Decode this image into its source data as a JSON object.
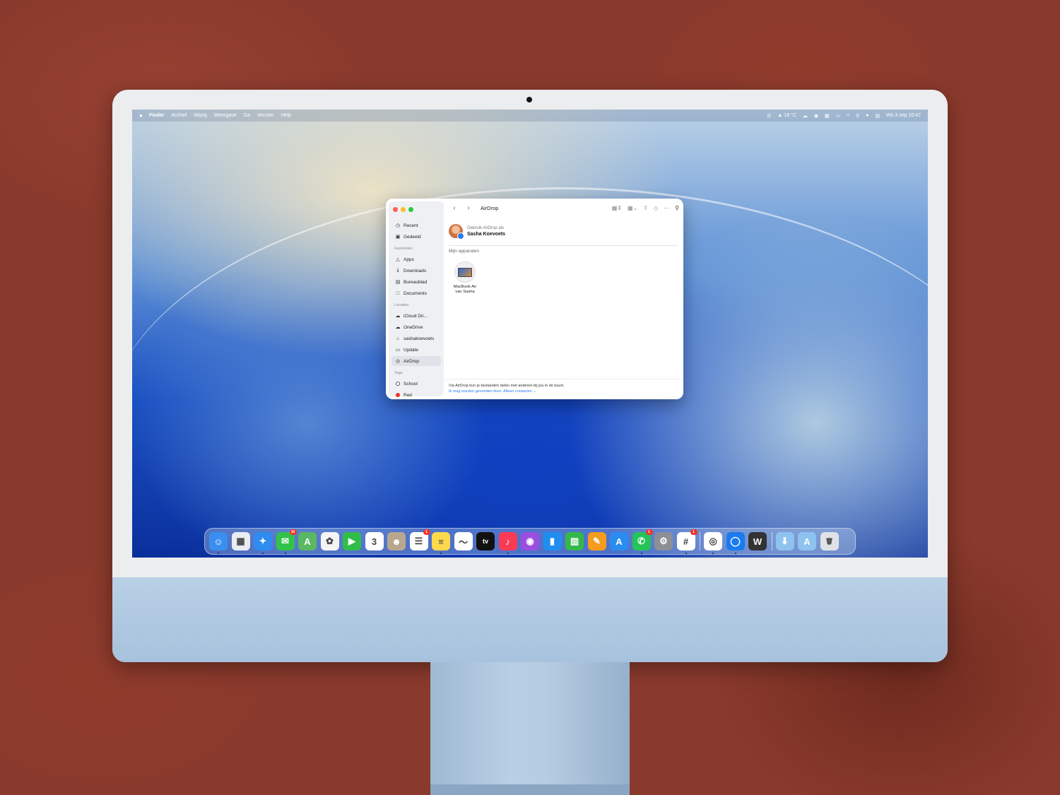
{
  "menubar": {
    "app": "Finder",
    "menus": [
      "Archief",
      "Wijzig",
      "Weergave",
      "Ga",
      "Venster",
      "Help"
    ],
    "weather": "19 °C",
    "clock": "Wo 3 sep  10:47"
  },
  "window": {
    "title": "AirDrop",
    "sidebar": {
      "items_top": [
        {
          "label": "Recent",
          "icon": "clock-icon"
        },
        {
          "label": "Gedeeld",
          "icon": "shared-folder-icon"
        }
      ],
      "favorites_header": "Favorieten",
      "favorites": [
        {
          "label": "Apps",
          "icon": "apps-icon"
        },
        {
          "label": "Downloads",
          "icon": "download-icon"
        },
        {
          "label": "Bureaublad",
          "icon": "desktop-icon"
        },
        {
          "label": "Documents",
          "icon": "document-icon"
        }
      ],
      "locations_header": "Locaties",
      "locations": [
        {
          "label": "iCloud Dri...",
          "icon": "cloud-icon"
        },
        {
          "label": "OneDrive",
          "icon": "cloud-icon"
        },
        {
          "label": "sashakoevoets",
          "icon": "home-icon"
        },
        {
          "label": "Update",
          "icon": "drive-icon"
        },
        {
          "label": "AirDrop",
          "icon": "airdrop-icon"
        }
      ],
      "tags_header": "Tags",
      "tags": [
        {
          "label": "School",
          "color": "#ffffff"
        },
        {
          "label": "Red",
          "color": "#e8352b"
        }
      ]
    },
    "me": {
      "label": "Gebruik AirDrop als",
      "name": "Sasha Koevoets"
    },
    "section": "Mijn apparaten",
    "device": {
      "line1": "MacBook Air",
      "line2": "van Sasha"
    },
    "footer": {
      "info": "Via AirDrop kun je bestanden delen met anderen bij jou in de buurt.",
      "discoverable": "Ik mag worden gevonden door: Alleen contacten"
    }
  },
  "dock": [
    {
      "name": "Finder",
      "icon": "finder-icon",
      "color": "#3a8ef0",
      "glyph": "☺",
      "running": true
    },
    {
      "name": "Launchpad",
      "icon": "launchpad-icon",
      "color": "#e9ecf2",
      "glyph": "▦"
    },
    {
      "name": "Safari",
      "icon": "safari-icon",
      "color": "#2f8cf0",
      "glyph": "✦",
      "running": true
    },
    {
      "name": "Berichten",
      "icon": "messages-icon",
      "color": "#31c24a",
      "glyph": "✉",
      "badge": "10",
      "running": true
    },
    {
      "name": "Kaarten",
      "icon": "maps-icon",
      "color": "#59b861",
      "glyph": "A"
    },
    {
      "name": "Foto's",
      "icon": "photos-icon",
      "color": "#f4f4f4",
      "glyph": "✿"
    },
    {
      "name": "FaceTime",
      "icon": "facetime-icon",
      "color": "#2fbe4a",
      "glyph": "▶"
    },
    {
      "name": "Agenda",
      "icon": "calendar-icon",
      "color": "#ffffff",
      "glyph": "3"
    },
    {
      "name": "Contacten",
      "icon": "contacts-icon",
      "color": "#b7a88d",
      "glyph": "☻"
    },
    {
      "name": "Herinneringen",
      "icon": "reminders-icon",
      "color": "#ffffff",
      "glyph": "☰",
      "badge": "1"
    },
    {
      "name": "Notities",
      "icon": "notes-icon",
      "color": "#fcd84b",
      "glyph": "≡",
      "running": true
    },
    {
      "name": "Freeform",
      "icon": "freeform-icon",
      "color": "#ffffff",
      "glyph": "〜"
    },
    {
      "name": "Apple TV",
      "icon": "tv-icon",
      "color": "#111111",
      "glyph": "tv"
    },
    {
      "name": "Muziek",
      "icon": "music-icon",
      "color": "#fa3a55",
      "glyph": "♪",
      "running": true
    },
    {
      "name": "Podcasts",
      "icon": "podcasts-icon",
      "color": "#9a4fe0",
      "glyph": "◉"
    },
    {
      "name": "Keynote",
      "icon": "keynote-icon",
      "color": "#1f8ef1",
      "glyph": "▮"
    },
    {
      "name": "Numbers",
      "icon": "numbers-icon",
      "color": "#33b84a",
      "glyph": "▥"
    },
    {
      "name": "Pages",
      "icon": "pages-icon",
      "color": "#f59b1d",
      "glyph": "✎"
    },
    {
      "name": "App Store",
      "icon": "appstore-icon",
      "color": "#2b8cf0",
      "glyph": "A"
    },
    {
      "name": "WhatsApp",
      "icon": "whatsapp-icon",
      "color": "#25c35a",
      "glyph": "✆",
      "badge": "1",
      "running": true
    },
    {
      "name": "Systeeminstellingen",
      "icon": "settings-icon",
      "color": "#8c8f95",
      "glyph": "⚙"
    },
    {
      "name": "Slack",
      "icon": "slack-icon",
      "color": "#ffffff",
      "glyph": "#",
      "badge": "1",
      "running": true
    }
  ],
  "dock_apps2": [
    {
      "name": "Chrome",
      "icon": "chrome-icon",
      "color": "#ffffff",
      "glyph": "◎",
      "running": true
    },
    {
      "name": "Quick Assist",
      "icon": "app-icon",
      "color": "#1a7bf0",
      "glyph": "◯",
      "running": true
    },
    {
      "name": "WebCatalog",
      "icon": "app-icon",
      "color": "#333333",
      "glyph": "W"
    }
  ],
  "dock_stacks": [
    {
      "name": "Downloads",
      "icon": "downloads-folder-icon",
      "color": "#8ec2ef",
      "glyph": "⬇"
    },
    {
      "name": "Apps",
      "icon": "apps-folder-icon",
      "color": "#8ec2ef",
      "glyph": "A"
    },
    {
      "name": "Prullenmand",
      "icon": "trash-icon",
      "color": "#dfe3e8",
      "glyph": "🗑"
    }
  ]
}
